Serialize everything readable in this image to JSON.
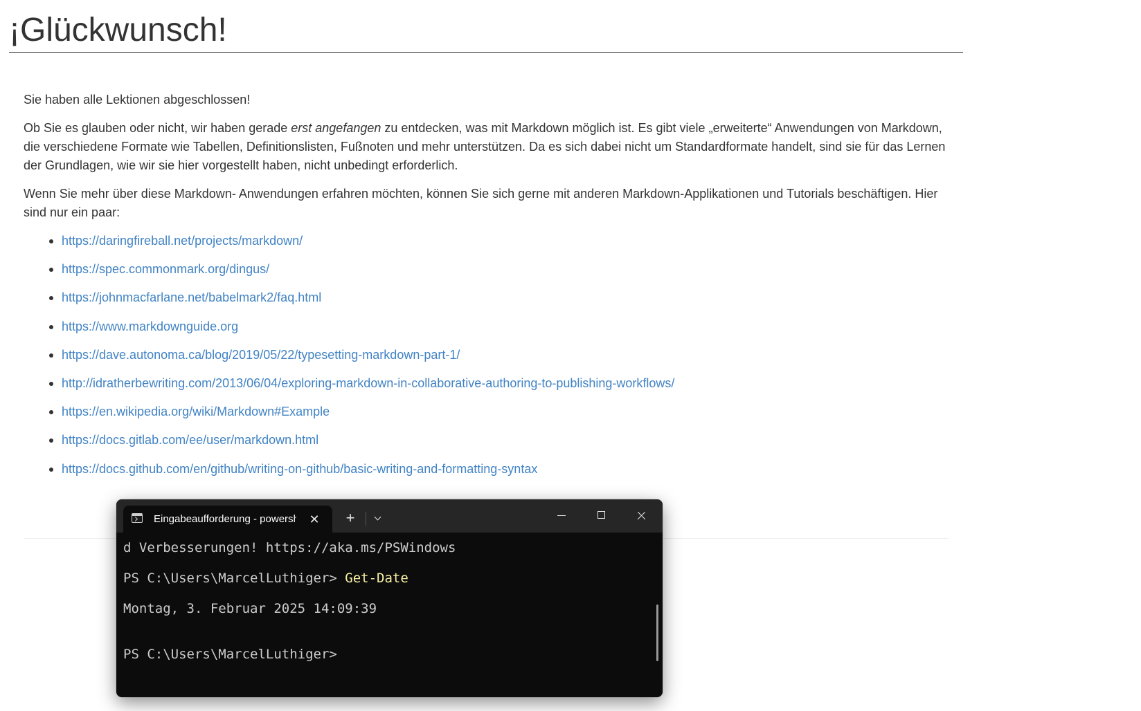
{
  "document": {
    "title": "¡Glückwunsch!",
    "intro": "Sie haben alle Lektionen abgeschlossen!",
    "para1_before": "Ob Sie es glauben oder nicht, wir haben gerade ",
    "para1_emphasis": "erst angefangen",
    "para1_after": " zu entdecken, was mit Markdown möglich ist. Es gibt viele „erweiterte“ Anwendungen von Markdown, die verschiedene Formate wie Tabellen, Definitionslisten, Fußnoten und mehr unterstützen. Da es sich dabei nicht um Standardformate handelt, sind sie für das Lernen der Grundlagen, wie wir sie hier vorgestellt haben, nicht unbedingt erforderlich.",
    "para2": "Wenn Sie mehr über diese Markdown- Anwendungen erfahren möchten, können Sie sich gerne mit anderen Markdown-Applikationen und Tutorials beschäftigen. Hier sind nur ein paar:",
    "links": [
      "https://daringfireball.net/projects/markdown/",
      "https://spec.commonmark.org/dingus/",
      "https://johnmacfarlane.net/babelmark2/faq.html",
      "https://www.markdownguide.org",
      "https://dave.autonoma.ca/blog/2019/05/22/typesetting-markdown-part-1/",
      "http://idratherbewriting.com/2013/06/04/exploring-markdown-in-collaborative-authoring-to-publishing-workflows/",
      "https://en.wikipedia.org/wiki/Markdown#Example",
      "https://docs.gitlab.com/ee/user/markdown.html",
      "https://docs.github.com/en/github/writing-on-github/basic-writing-and-formatting-syntax"
    ]
  },
  "terminal": {
    "tab_title": "Eingabeaufforderung - powershell",
    "tab_icon": "terminal-icon",
    "close_tab_glyph": "✕",
    "new_tab_glyph": "+",
    "lines": {
      "line1": "d Verbesserungen! https://aka.ms/PSWindows",
      "prompt1": "PS C:\\Users\\MarcelLuthiger> ",
      "command1": "Get-Date",
      "output1": "Montag, 3. Februar 2025 14:09:39",
      "prompt2": "PS C:\\Users\\MarcelLuthiger>"
    },
    "colors": {
      "background": "#0c0c0c",
      "titlebar": "#262626",
      "text": "#cccccc",
      "command": "#f9f1a5"
    }
  },
  "colors": {
    "link": "#4183c4",
    "text": "#333333"
  }
}
